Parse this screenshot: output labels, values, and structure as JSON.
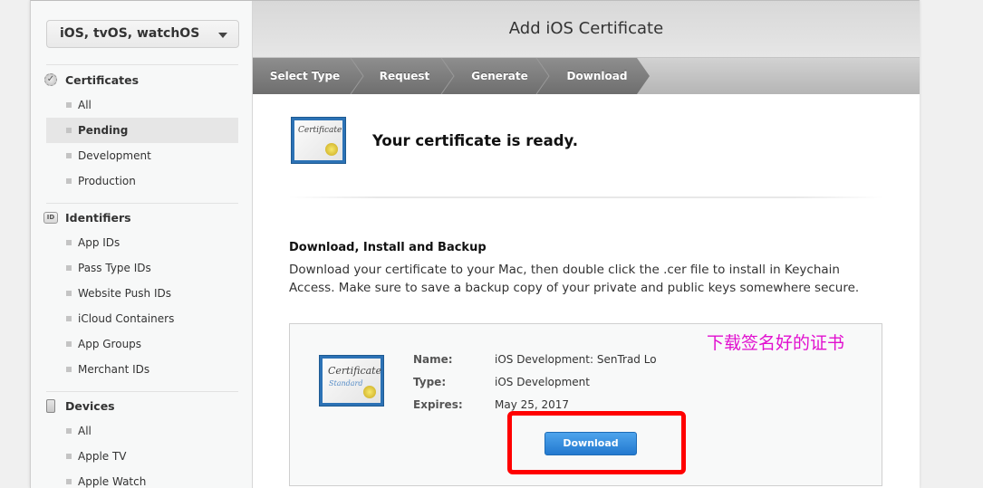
{
  "sidebar": {
    "platform_select": "iOS, tvOS, watchOS",
    "sections": [
      {
        "title": "Certificates",
        "icon": "certificate-gear-icon",
        "items": [
          {
            "label": "All"
          },
          {
            "label": "Pending",
            "active": true
          },
          {
            "label": "Development"
          },
          {
            "label": "Production"
          }
        ]
      },
      {
        "title": "Identifiers",
        "icon": "id-icon",
        "items": [
          {
            "label": "App IDs"
          },
          {
            "label": "Pass Type IDs"
          },
          {
            "label": "Website Push IDs"
          },
          {
            "label": "iCloud Containers"
          },
          {
            "label": "App Groups"
          },
          {
            "label": "Merchant IDs"
          }
        ]
      },
      {
        "title": "Devices",
        "icon": "device-icon",
        "items": [
          {
            "label": "All"
          },
          {
            "label": "Apple TV"
          },
          {
            "label": "Apple Watch"
          }
        ]
      }
    ]
  },
  "header": {
    "title": "Add iOS Certificate",
    "steps": [
      "Select Type",
      "Request",
      "Generate",
      "Download"
    ]
  },
  "main": {
    "ready_icon_text": "Certificate",
    "ready_message": "Your certificate is ready.",
    "download_section": {
      "title": "Download, Install and Backup",
      "description": "Download your certificate to your Mac, then double click the .cer file to install in Keychain Access. Make sure to save a backup copy of your private and public keys somewhere secure."
    },
    "certificate": {
      "icon_text": "Certificate",
      "icon_subtext": "Standard",
      "details": [
        {
          "label": "Name:",
          "value": "iOS Development: SenTrad Lo"
        },
        {
          "label": "Type:",
          "value": "iOS Development"
        },
        {
          "label": "Expires:",
          "value": "May 25, 2017"
        }
      ],
      "download_button": "Download"
    },
    "annotation": "下载签名好的证书",
    "colors": {
      "annotation": "#e10fcf",
      "highlight_box": "#ff0000",
      "button": "#2f86d8"
    }
  }
}
